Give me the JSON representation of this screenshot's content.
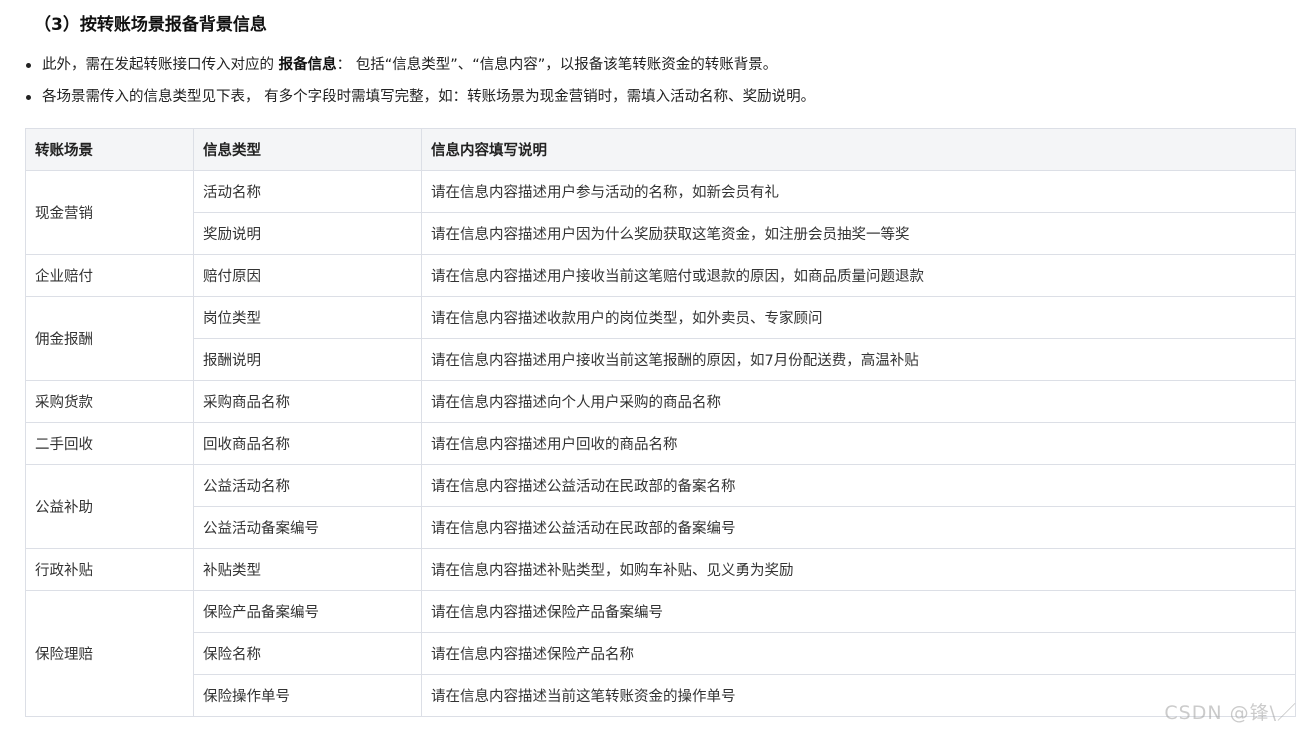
{
  "heading": "（3）按转账场景报备背景信息",
  "bullets": [
    {
      "before": "此外，需在发起转账接口传入对应的 ",
      "bold": "报备信息",
      "after": "： 包括“信息类型”、“信息内容”，以报备该笔转账资金的转账背景。"
    },
    {
      "before": "各场景需传入的信息类型见下表， 有多个字段时需填写完整，如：转账场景为现金营销时，需填入活动名称、奖励说明。",
      "bold": "",
      "after": ""
    }
  ],
  "table": {
    "headers": [
      "转账场景",
      "信息类型",
      "信息内容填写说明"
    ],
    "groups": [
      {
        "scene": "现金营销",
        "rows": [
          {
            "type": "活动名称",
            "desc": "请在信息内容描述用户参与活动的名称，如新会员有礼"
          },
          {
            "type": "奖励说明",
            "desc": "请在信息内容描述用户因为什么奖励获取这笔资金，如注册会员抽奖一等奖"
          }
        ]
      },
      {
        "scene": "企业赔付",
        "rows": [
          {
            "type": "赔付原因",
            "desc": "请在信息内容描述用户接收当前这笔赔付或退款的原因，如商品质量问题退款"
          }
        ]
      },
      {
        "scene": "佣金报酬",
        "rows": [
          {
            "type": "岗位类型",
            "desc": "请在信息内容描述收款用户的岗位类型，如外卖员、专家顾问"
          },
          {
            "type": "报酬说明",
            "desc": "请在信息内容描述用户接收当前这笔报酬的原因，如7月份配送费，高温补贴"
          }
        ]
      },
      {
        "scene": "采购货款",
        "rows": [
          {
            "type": "采购商品名称",
            "desc": "请在信息内容描述向个人用户采购的商品名称"
          }
        ]
      },
      {
        "scene": "二手回收",
        "rows": [
          {
            "type": "回收商品名称",
            "desc": "请在信息内容描述用户回收的商品名称"
          }
        ]
      },
      {
        "scene": "公益补助",
        "rows": [
          {
            "type": "公益活动名称",
            "desc": "请在信息内容描述公益活动在民政部的备案名称"
          },
          {
            "type": "公益活动备案编号",
            "desc": "请在信息内容描述公益活动在民政部的备案编号"
          }
        ]
      },
      {
        "scene": "行政补贴",
        "rows": [
          {
            "type": "补贴类型",
            "desc": "请在信息内容描述补贴类型，如购车补贴、见义勇为奖励"
          }
        ]
      },
      {
        "scene": "保险理赔",
        "rows": [
          {
            "type": "保险产品备案编号",
            "desc": "请在信息内容描述保险产品备案编号"
          },
          {
            "type": "保险名称",
            "desc": "请在信息内容描述保险产品名称"
          },
          {
            "type": "保险操作单号",
            "desc": "请在信息内容描述当前这笔转账资金的操作单号"
          }
        ]
      }
    ]
  },
  "watermark": "CSDN @锋\\／"
}
